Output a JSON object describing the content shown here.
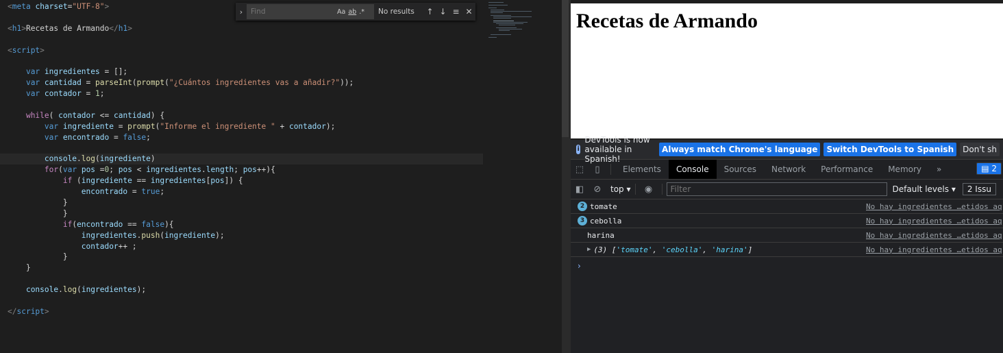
{
  "editor": {
    "find": {
      "placeholder": "Find",
      "match_case": "Aa",
      "whole_word": "ab",
      "regex": ".*",
      "results": "No results"
    }
  },
  "browser": {
    "page_heading": "Recetas de Armando",
    "devtools": {
      "infobar": {
        "message": "DevTools is now available in Spanish!",
        "btn_match": "Always match Chrome's language",
        "btn_switch": "Switch DevTools to Spanish",
        "btn_dont": "Don't sh"
      },
      "tabs": [
        "Elements",
        "Console",
        "Sources",
        "Network",
        "Performance",
        "Memory"
      ],
      "more": "»",
      "issues_count": "2",
      "context": "top",
      "filter_placeholder": "Filter",
      "levels": "Default levels",
      "issues_label": "2 Issu",
      "console": {
        "rows": [
          {
            "count": "2",
            "text": "tomate",
            "source": "No hay ingredientes …etidos aq"
          },
          {
            "count": "3",
            "text": "cebolla",
            "source": "No hay ingredientes …etidos aq"
          },
          {
            "count": "",
            "text": "harina",
            "source": "No hay ingredientes …etidos aq"
          }
        ],
        "array_prefix": "(3) [",
        "array_items": [
          "'tomate'",
          "'cebolla'",
          "'harina'"
        ],
        "array_suffix": "]",
        "array_source": "No hay ingredientes …etidos aq",
        "prompt": "›"
      }
    }
  },
  "colors": {
    "accent": "#1a73e8",
    "editor_bg": "#1e1e1e",
    "devtools_bg": "#202124"
  }
}
